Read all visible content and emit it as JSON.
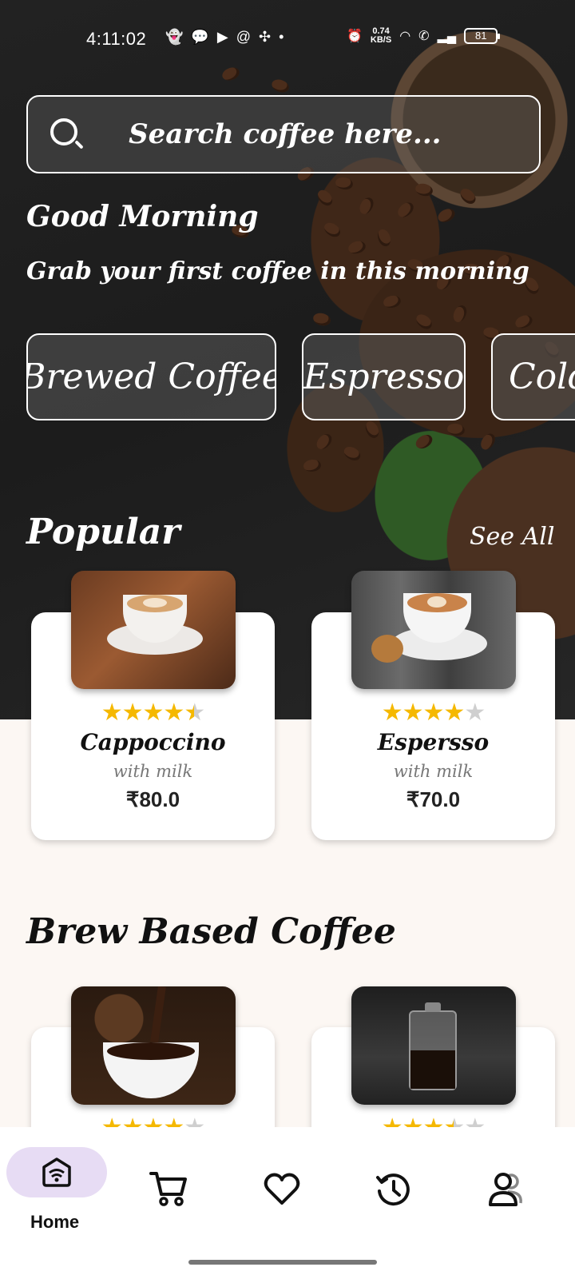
{
  "status_bar": {
    "time": "4:11:02",
    "network_speed": "0.74",
    "network_speed_unit": "KB/S",
    "battery": "81"
  },
  "search": {
    "placeholder": "Search coffee here..."
  },
  "greeting": {
    "title": "Good Morning",
    "subtitle": "Grab your first coffee in this morning"
  },
  "categories": [
    "Brewed Coffee",
    "Espresso",
    "Cold"
  ],
  "popular": {
    "title": "Popular",
    "see_all": "See All",
    "items": [
      {
        "name": "Cappoccino",
        "subtitle": "with milk",
        "price": "₹80.0",
        "rating": 4.5
      },
      {
        "name": "Espersso",
        "subtitle": "with milk",
        "price": "₹70.0",
        "rating": 4
      }
    ]
  },
  "brew_based": {
    "title": "Brew Based Coffee",
    "items": [
      {
        "rating": 4
      },
      {
        "rating": 3.5
      }
    ]
  },
  "bottom_nav": {
    "active": "Home",
    "items": [
      {
        "label": "Home",
        "icon": "home-wifi-icon"
      },
      {
        "icon": "cart-icon"
      },
      {
        "icon": "heart-icon"
      },
      {
        "icon": "history-icon"
      },
      {
        "icon": "profile-icon"
      }
    ]
  },
  "colors": {
    "star": "#f5b800",
    "nav_active_pill": "#e7dcf4",
    "page_background": "#fcf7f3"
  }
}
